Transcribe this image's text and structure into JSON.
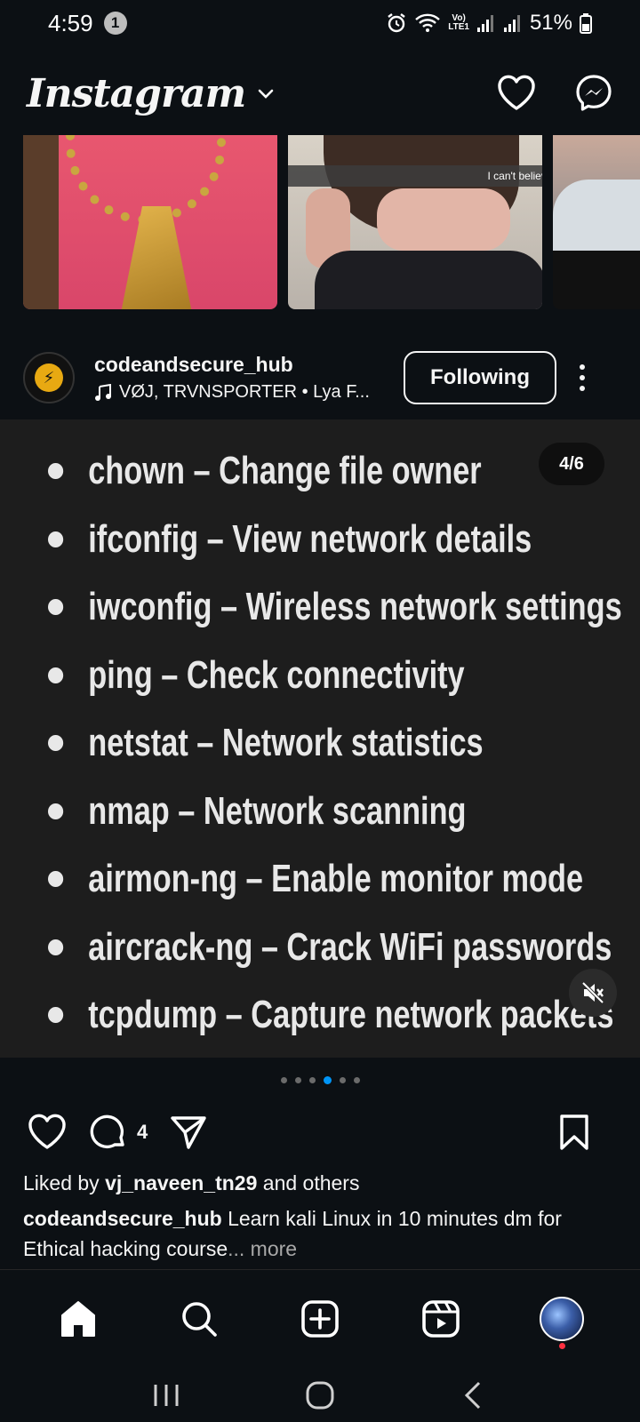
{
  "status_bar": {
    "time": "4:59",
    "notification_count": "1",
    "volte_top": "Vo)",
    "volte_bottom": "LTE1",
    "battery": "51%"
  },
  "header": {
    "brand": "Instagram"
  },
  "thumbnails": {
    "caption_2": "I can't believe she was sleeping in class😴"
  },
  "post": {
    "username": "codeandsecure_hub",
    "audio": "VØJ, TRVNSPORTER • Lya F...",
    "follow_label": "Following",
    "slide_indicator": "4/6",
    "commands": [
      "chown – Change file owner",
      "ifconfig – View network details",
      "iwconfig – Wireless network settings",
      "ping – Check connectivity",
      "netstat – Network statistics",
      "nmap – Network scanning",
      "airmon-ng – Enable monitor mode",
      "aircrack-ng – Crack WiFi passwords",
      "tcpdump – Capture network packets"
    ],
    "carousel": {
      "total": 6,
      "active_index": 4
    },
    "comment_count": "4",
    "likes_prefix": "Liked by ",
    "likes_user": "vj_naveen_tn29",
    "likes_suffix": " and others",
    "caption_user": "codeandsecure_hub",
    "caption_text": " Learn kali Linux in 10 minutes dm for Ethical hacking course",
    "caption_more": "... more"
  },
  "colors": {
    "background": "#0c1014",
    "media_background": "#1d1d1d",
    "active_dot": "#0095f6",
    "notification_red": "#ff3040"
  }
}
